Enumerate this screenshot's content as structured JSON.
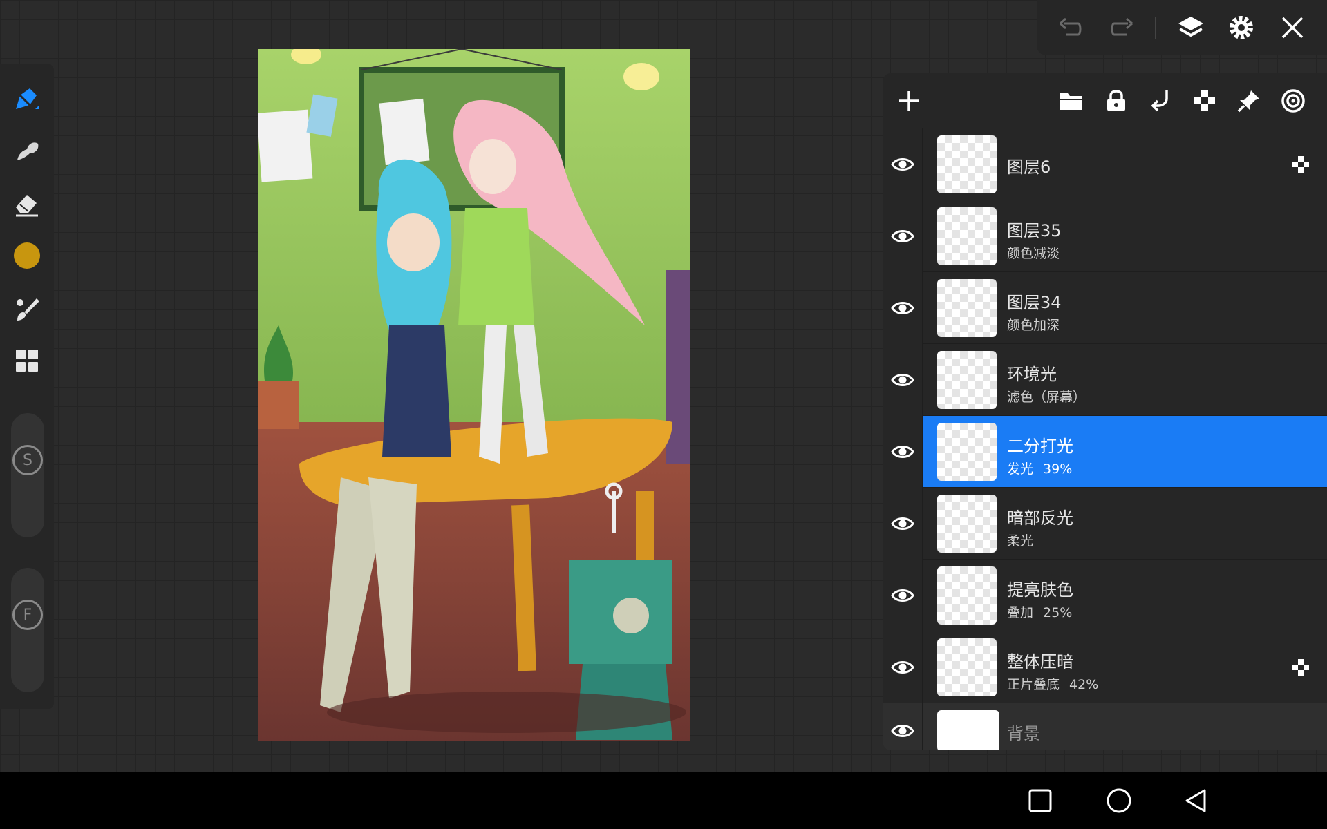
{
  "app": {
    "accent_color": "#1a7cf5",
    "panel_color": "#262626"
  },
  "left_toolbar": {
    "tools": [
      {
        "id": "pen",
        "icon": "pen-icon",
        "active": true
      },
      {
        "id": "smudge",
        "icon": "smudge-icon"
      },
      {
        "id": "eraser",
        "icon": "eraser-icon"
      },
      {
        "id": "color",
        "icon": "color-swatch",
        "color": "#c8960f"
      },
      {
        "id": "brush-settings",
        "icon": "brush-settings-icon"
      },
      {
        "id": "menu",
        "icon": "grid-menu-icon"
      }
    ],
    "size_slider_label": "S",
    "opacity_slider_label": "F"
  },
  "top_toolbar": {
    "buttons": [
      "undo-icon",
      "redo-icon",
      "layers-icon",
      "gear-icon",
      "close-icon"
    ]
  },
  "layer_panel": {
    "header_buttons": [
      "add-layer-icon",
      "folder-icon",
      "lock-icon",
      "merge-down-icon",
      "alpha-lock-icon",
      "pin-icon",
      "target-icon"
    ],
    "layers": [
      {
        "name": "图层6",
        "mode": "",
        "opacity": "",
        "visible": true,
        "alpha_lock": true
      },
      {
        "name": "图层35",
        "mode": "颜色减淡",
        "opacity": "",
        "visible": true
      },
      {
        "name": "图层34",
        "mode": "颜色加深",
        "opacity": "",
        "visible": true
      },
      {
        "name": "环境光",
        "mode": "滤色（屏幕）",
        "opacity": "",
        "visible": true
      },
      {
        "name": "二分打光",
        "mode": "发光",
        "opacity": "39%",
        "visible": true,
        "selected": true
      },
      {
        "name": "暗部反光",
        "mode": "柔光",
        "opacity": "",
        "visible": true
      },
      {
        "name": "提亮肤色",
        "mode": "叠加",
        "opacity": "25%",
        "visible": true
      },
      {
        "name": "整体压暗",
        "mode": "正片叠底",
        "opacity": "42%",
        "visible": true,
        "alpha_lock": true
      }
    ],
    "background_layer": {
      "name": "背景",
      "visible": true
    }
  },
  "navbar": {
    "buttons": [
      "recents-icon",
      "home-icon",
      "back-icon"
    ]
  }
}
